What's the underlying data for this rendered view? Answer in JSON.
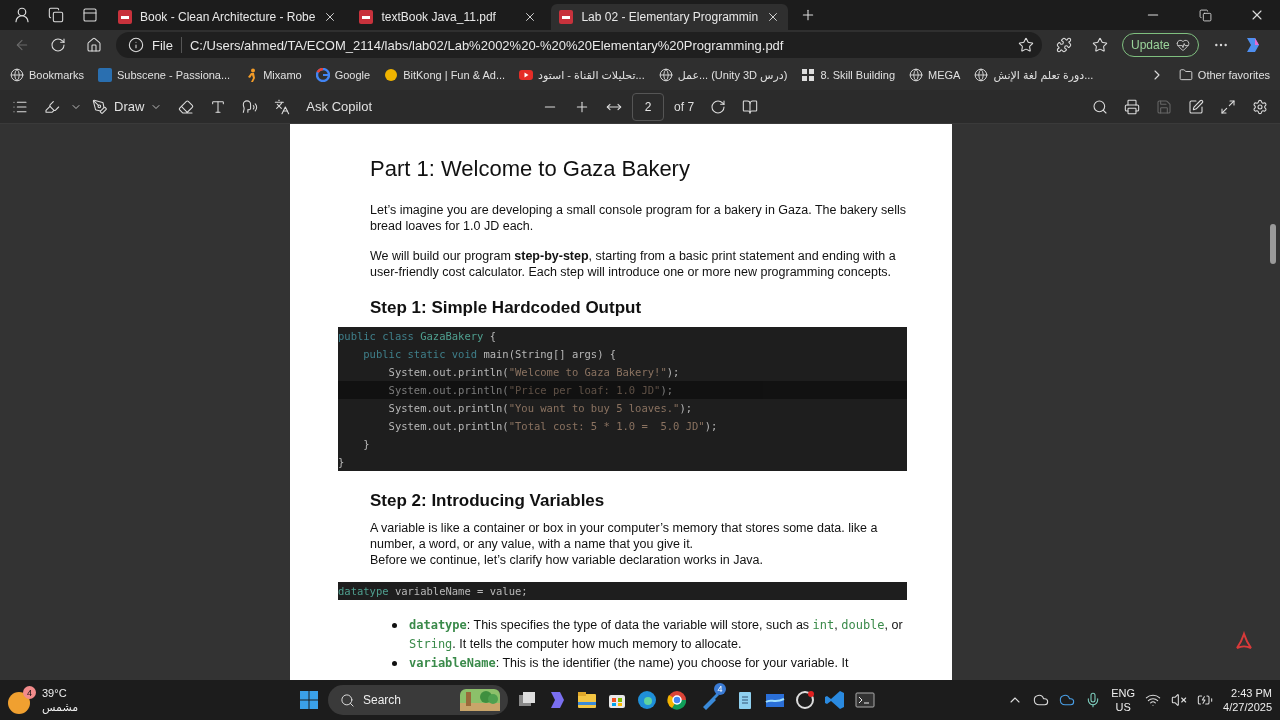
{
  "tabs": [
    {
      "title": "Book - Clean Architecture - Robe",
      "selected": false
    },
    {
      "title": "textBook Java_11.pdf",
      "selected": false
    },
    {
      "title": "Lab 02 - Elementary Programmin",
      "selected": true
    }
  ],
  "address": {
    "scheme": "File",
    "url": "C:/Users/ahmed/TA/ECOM_2114/labs/lab02/Lab%2002%20-%20%20Elementary%20Programming.pdf"
  },
  "update_button": "Update",
  "bookmarks": [
    {
      "label": "Bookmarks"
    },
    {
      "label": "Subscene - Passiona..."
    },
    {
      "label": "Mixamo"
    },
    {
      "label": "Google"
    },
    {
      "label": "BitKong | Fun & Ad..."
    },
    {
      "label": "تحليلات القناة - استود..."
    },
    {
      "label": "عمل... (Unity 3D درس)"
    },
    {
      "label": "8. Skill Building"
    },
    {
      "label": "MEGA"
    },
    {
      "label": "دورة تعلم لغة الإنش..."
    }
  ],
  "other_favorites": "Other favorites",
  "pdf_toolbar": {
    "draw": "Draw",
    "ask": "Ask Copilot",
    "page": "2",
    "of": "of 7"
  },
  "document": [
    {
      "kind": "title",
      "text": "Part 1: Welcome to Gaza Bakery"
    },
    {
      "kind": "para",
      "text": "Let’s imagine you are developing a small console program for a bakery in Gaza. The bakery sells bread loaves for 1.0 JD each."
    },
    {
      "kind": "para",
      "text": "We will build our program **step-by-step**, starting from a basic print statement and ending with a user-friendly cost calculator. Each step will introduce one or more new programming concepts."
    },
    {
      "kind": "heading",
      "text": "Step 1: Simple Hardcoded Output"
    },
    {
      "kind": "code",
      "lines": [
        {
          "highlighted": false,
          "parts": [
            {
              "kind": "kw",
              "text": "public class "
            },
            {
              "kind": "name",
              "text": "GazaBakery"
            },
            {
              "kind": "plain",
              "text": " {"
            }
          ]
        },
        {
          "highlighted": false,
          "parts": [
            {
              "kind": "kw",
              "text": "    public static void "
            },
            {
              "kind": "plain",
              "text": "main(String[] args) {"
            }
          ]
        },
        {
          "highlighted": false,
          "parts": [
            {
              "kind": "plain",
              "text": "        System.out.println("
            },
            {
              "kind": "str",
              "text": "\"Welcome to Gaza Bakery!\""
            },
            {
              "kind": "plain",
              "text": ");"
            }
          ]
        },
        {
          "highlighted": true,
          "parts": [
            {
              "kind": "plain",
              "text": "        System.out.println("
            },
            {
              "kind": "str",
              "text": "\"Price per loaf: 1.0 JD\""
            },
            {
              "kind": "plain",
              "text": ");"
            }
          ]
        },
        {
          "highlighted": false,
          "parts": [
            {
              "kind": "plain",
              "text": "        System.out.println("
            },
            {
              "kind": "str",
              "text": "\"You want to buy 5 loaves.\""
            },
            {
              "kind": "plain",
              "text": ");"
            }
          ]
        },
        {
          "highlighted": false,
          "parts": [
            {
              "kind": "plain",
              "text": "        System.out.println("
            },
            {
              "kind": "str",
              "text": "\"Total cost: 5 * 1.0 =  5.0 JD\""
            },
            {
              "kind": "plain",
              "text": ");"
            }
          ]
        },
        {
          "highlighted": false,
          "parts": [
            {
              "kind": "plain",
              "text": "    }"
            }
          ]
        },
        {
          "highlighted": false,
          "parts": [
            {
              "kind": "plain",
              "text": "}"
            }
          ]
        }
      ]
    },
    {
      "kind": "heading",
      "text": "Step 2: Introducing Variables"
    },
    {
      "kind": "para",
      "text": "A variable is like a container or box in your computer’s memory that stores some data. like a number, a word, or any value, with a name that you give it.\nBefore we continue, let’s clarify how variable declaration works in Java."
    },
    {
      "kind": "code",
      "lines": [
        {
          "highlighted": false,
          "parts": [
            {
              "kind": "name",
              "text": "datatype"
            },
            {
              "kind": "plain",
              "text": " variableName = value;"
            }
          ]
        }
      ]
    },
    {
      "kind": "bullets",
      "items": [
        [
          {
            "kind": "term",
            "text": "datatype"
          },
          {
            "kind": "text",
            "text": ": This specifies the type of data the variable will store, such as "
          },
          {
            "kind": "code",
            "text": "int"
          },
          {
            "kind": "text",
            "text": ", "
          },
          {
            "kind": "code",
            "text": "double"
          },
          {
            "kind": "text",
            "text": ", or "
          },
          {
            "kind": "code",
            "text": "String"
          },
          {
            "kind": "text",
            "text": ". It tells the computer how much memory to allocate."
          }
        ],
        [
          {
            "kind": "term",
            "text": "variableName"
          },
          {
            "kind": "text",
            "text": ": This is the identifier (the name) you choose for your variable. It"
          }
        ]
      ]
    }
  ],
  "taskbar": {
    "weather_badge": "4",
    "temperature": "39°C",
    "condition": "مشمس",
    "search": "Search",
    "steam_badge": "4",
    "lang": "ENG",
    "region": "US",
    "time": "2:43 PM",
    "date": "4/27/2025"
  }
}
